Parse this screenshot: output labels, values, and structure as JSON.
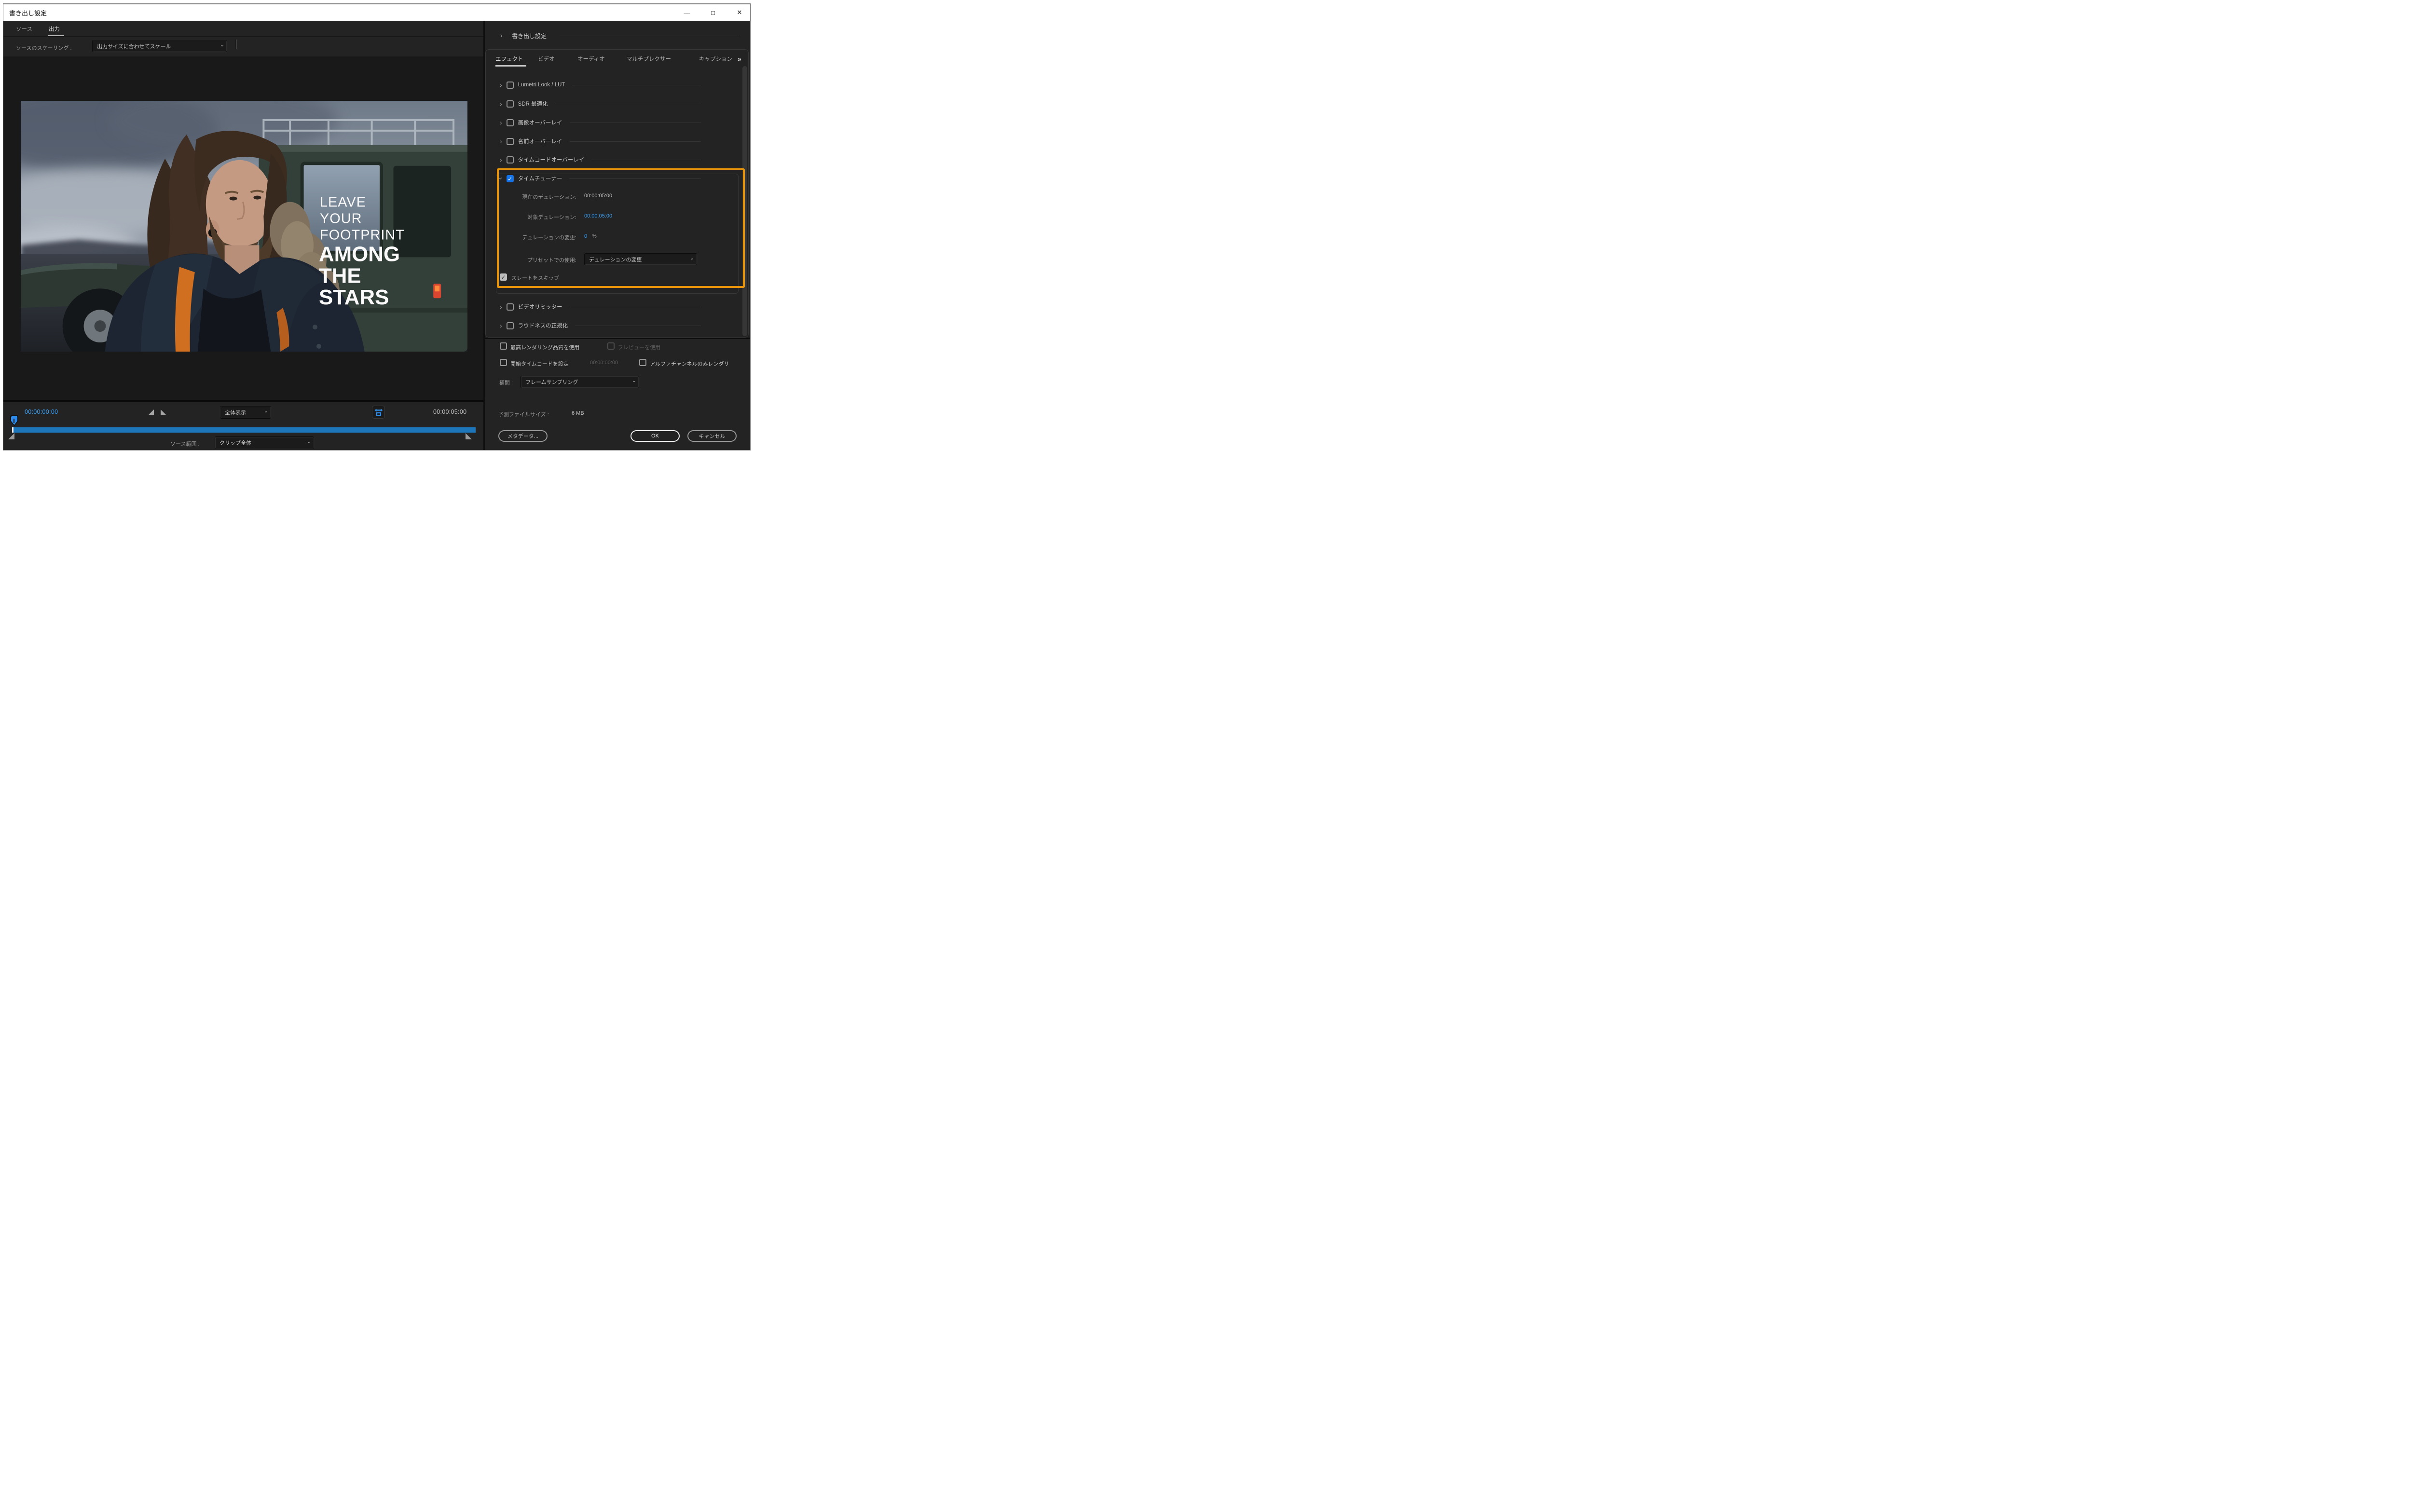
{
  "window": {
    "title": "書き出し設定",
    "controls": {
      "minimize": "—",
      "maximize": "□",
      "close": "✕"
    }
  },
  "left": {
    "tabs": [
      {
        "label": "ソース",
        "active": false
      },
      {
        "label": "出力",
        "active": true
      }
    ],
    "scaling": {
      "label": "ソースのスケーリング :",
      "value": "出力サイズに合わせてスケール"
    },
    "preview": {
      "light_lines": [
        "LEAVE",
        "YOUR",
        "FOOTPRINT"
      ],
      "bold_lines": [
        "AMONG",
        "THE",
        "STARS"
      ]
    },
    "transport": {
      "current_time": "00:00:00:00",
      "duration": "00:00:05:00",
      "zoom_value": "全体表示",
      "range_label": "ソース範囲 :",
      "range_value": "クリップ全体"
    }
  },
  "right": {
    "header": "書き出し設定",
    "tabs": [
      "エフェクト",
      "ビデオ",
      "オーディオ",
      "マルチプレクサー",
      "キャプション"
    ],
    "tabs_overflow_icon": "»",
    "effects": [
      {
        "label": "Lumetri Look / LUT",
        "checked": false
      },
      {
        "label": "SDR 最適化",
        "checked": false
      },
      {
        "label": "画像オーバーレイ",
        "checked": false
      },
      {
        "label": "名前オーバーレイ",
        "checked": false
      },
      {
        "label": "タイムコードオーバーレイ",
        "checked": false
      },
      {
        "label": "タイムチューナー",
        "checked": true,
        "expanded": true
      },
      {
        "label": "ビデオリミッター",
        "checked": false
      },
      {
        "label": "ラウドネスの正規化",
        "checked": false
      }
    ],
    "check_glyph": "✓",
    "time_tuner": {
      "rows": [
        {
          "label": "現在のデュレーション:",
          "value": "00:00:05:00"
        },
        {
          "label": "対象デュレーション:",
          "value": "00:00:05:00"
        },
        {
          "label": "デュレーションの変更:",
          "value": "0",
          "suffix": "%"
        }
      ],
      "preset": {
        "label": "プリセットでの使用:",
        "value": "デュレーションの変更"
      },
      "skip_slate": {
        "label": "スレートをスキップ",
        "checked": true
      }
    },
    "options": {
      "max_quality": "最高レンダリング品質を使用",
      "use_previews": "プレビューを使用",
      "set_start_tc": "開始タイムコードを設定",
      "start_tc_value": "00:00:00:00",
      "alpha_only": "アルファチャンネルのみレンダリ",
      "interp_label": "補間 :",
      "interp_value": "フレームサンプリング",
      "estimate_label": "予測ファイルサイズ :",
      "estimate_value": "6 MB"
    },
    "buttons": {
      "metadata": "メタデータ...",
      "ok": "OK",
      "cancel": "キャンセル"
    }
  },
  "colors": {
    "accent_blue": "#3aa0f5",
    "checkbox_blue": "#1473e6",
    "annotation_orange": "#e8930c",
    "timeline_blue": "#1d76b9"
  }
}
